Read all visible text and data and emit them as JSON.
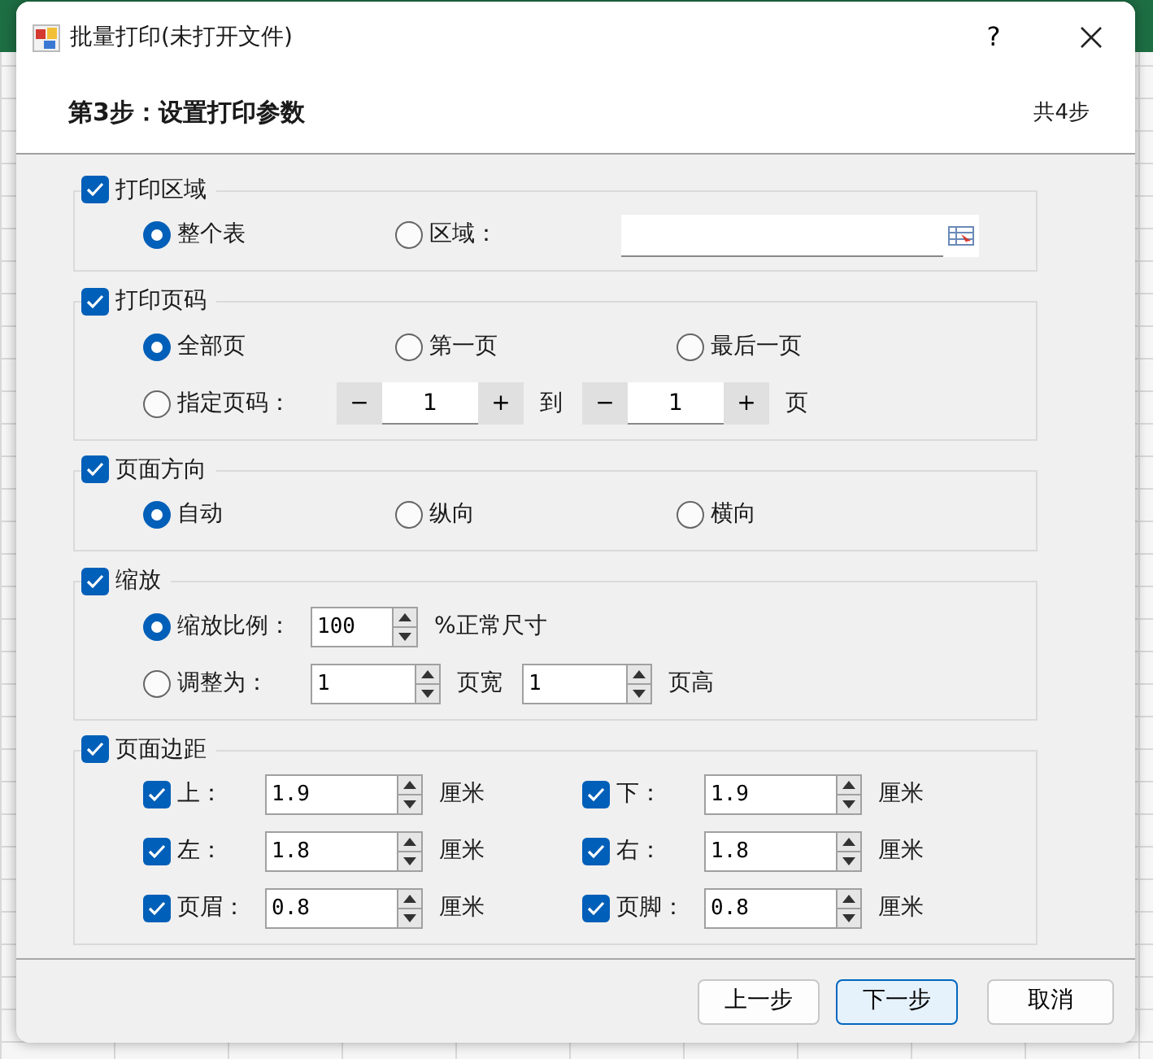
{
  "window": {
    "title": "批量打印(未打开文件)",
    "help": "?"
  },
  "header": {
    "step": "第3步：设置打印参数",
    "total": "共4步"
  },
  "sections": [
    {
      "label": "打印区域",
      "checked": true,
      "rows": [
        {
          "items": [
            {
              "kind": "radio",
              "label": "整个表",
              "selected": true
            },
            {
              "kind": "radio",
              "label": "区域：",
              "selected": false
            },
            {
              "kind": "range"
            }
          ]
        }
      ]
    },
    {
      "label": "打印页码",
      "checked": true,
      "rows": [
        {
          "items": [
            {
              "kind": "radio",
              "label": "全部页",
              "selected": true
            },
            {
              "kind": "radio",
              "label": "第一页",
              "selected": false
            },
            {
              "kind": "radio",
              "label": "最后一页",
              "selected": false
            }
          ]
        },
        {
          "items": [
            {
              "kind": "radio",
              "label": "指定页码：",
              "selected": false
            },
            {
              "kind": "stepper",
              "minus": "−",
              "value": "1",
              "plus": "+"
            },
            {
              "kind": "text",
              "text": "到"
            },
            {
              "kind": "stepper",
              "minus": "−",
              "value": "1",
              "plus": "+"
            },
            {
              "kind": "text",
              "text": "页"
            }
          ]
        }
      ]
    },
    {
      "label": "页面方向",
      "checked": true,
      "rows": [
        {
          "items": [
            {
              "kind": "radio",
              "label": "自动",
              "selected": true
            },
            {
              "kind": "radio",
              "label": "纵向",
              "selected": false
            },
            {
              "kind": "radio",
              "label": "横向",
              "selected": false
            }
          ]
        }
      ]
    },
    {
      "label": "缩放",
      "checked": true,
      "rows": [
        {
          "items": [
            {
              "kind": "radio",
              "label": "缩放比例：",
              "selected": true
            },
            {
              "kind": "spin",
              "value": "100"
            },
            {
              "kind": "text",
              "text": "%正常尺寸"
            }
          ]
        },
        {
          "items": [
            {
              "kind": "radio",
              "label": "调整为：",
              "selected": false
            },
            {
              "kind": "spin",
              "value": "1"
            },
            {
              "kind": "text",
              "text": "页宽"
            },
            {
              "kind": "spin",
              "value": "1"
            },
            {
              "kind": "text",
              "text": "页高"
            }
          ]
        }
      ]
    },
    {
      "label": "页面边距",
      "checked": true,
      "rows": [
        {
          "items": [
            {
              "kind": "check",
              "label": "上：",
              "checked": true
            },
            {
              "kind": "spin",
              "value": "1.9"
            },
            {
              "kind": "text",
              "text": "厘米"
            },
            {
              "kind": "check",
              "label": "下：",
              "checked": true
            },
            {
              "kind": "spin",
              "value": "1.9"
            },
            {
              "kind": "text",
              "text": "厘米"
            }
          ]
        },
        {
          "items": [
            {
              "kind": "check",
              "label": "左：",
              "checked": true
            },
            {
              "kind": "spin",
              "value": "1.8"
            },
            {
              "kind": "text",
              "text": "厘米"
            },
            {
              "kind": "check",
              "label": "右：",
              "checked": true
            },
            {
              "kind": "spin",
              "value": "1.8"
            },
            {
              "kind": "text",
              "text": "厘米"
            }
          ]
        },
        {
          "items": [
            {
              "kind": "check",
              "label": "页眉：",
              "checked": true
            },
            {
              "kind": "spin",
              "value": "0.8"
            },
            {
              "kind": "text",
              "text": "厘米"
            },
            {
              "kind": "check",
              "label": "页脚：",
              "checked": true
            },
            {
              "kind": "spin",
              "value": "0.8"
            },
            {
              "kind": "text",
              "text": "厘米"
            }
          ]
        }
      ]
    }
  ],
  "buttons": [
    {
      "label": "上一步",
      "default": false
    },
    {
      "label": "下一步",
      "default": true
    },
    {
      "label": "取消",
      "default": false
    }
  ]
}
